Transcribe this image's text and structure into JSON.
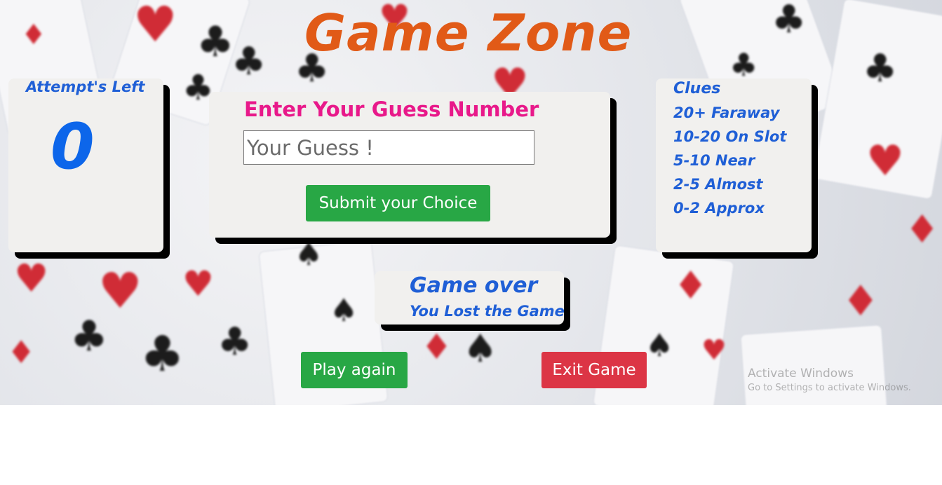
{
  "title": "Game Zone",
  "attempts": {
    "label": "Attempt's Left",
    "value": "0"
  },
  "guess": {
    "heading": "Enter Your Guess Number",
    "placeholder": "Your Guess !",
    "submit_label": "Submit your Choice"
  },
  "clues": {
    "title": "Clues",
    "items": [
      "20+ Faraway",
      "10-20 On Slot",
      "5-10 Near",
      "2-5 Almost",
      "0-2 Approx"
    ]
  },
  "result": {
    "title": "Game over",
    "message": "You Lost the Game"
  },
  "actions": {
    "play_again_label": "Play again",
    "exit_label": "Exit Game"
  },
  "watermark": {
    "line1": "Activate Windows",
    "line2": "Go to Settings to activate Windows."
  },
  "colors": {
    "title": "#e15a17",
    "heading": "#e8198a",
    "text_blue": "#1f5fd6",
    "success": "#28a745",
    "danger": "#dc3545"
  }
}
